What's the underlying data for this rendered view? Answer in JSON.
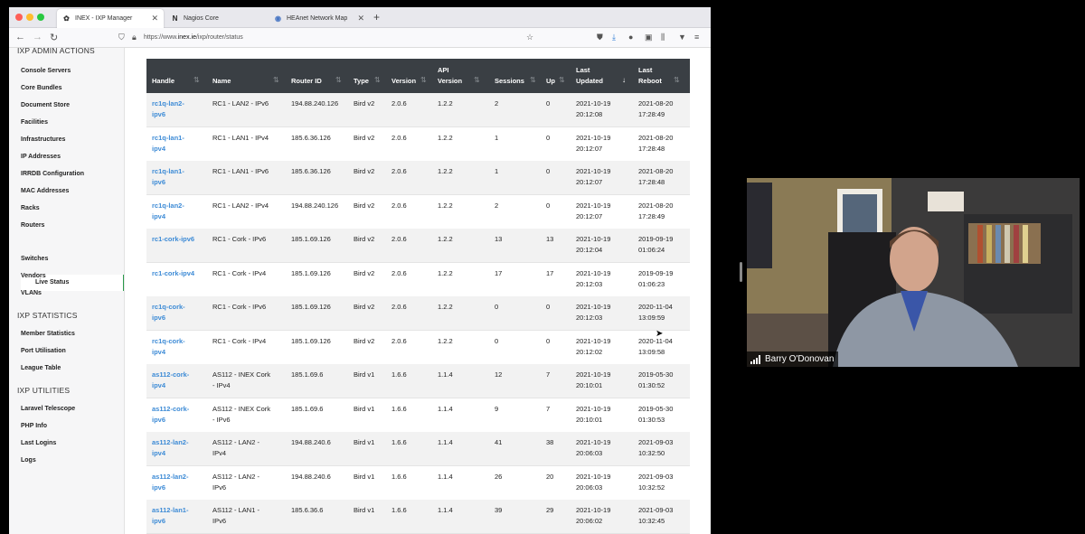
{
  "browser": {
    "tabs": [
      {
        "label": "INEX - IXP Manager",
        "icon": "ixp-favicon",
        "active": true
      },
      {
        "label": "Nagios Core",
        "icon": "nagios-favicon",
        "active": false
      },
      {
        "label": "HEAnet Network Map",
        "icon": "globe-favicon",
        "active": false
      }
    ],
    "url_prefix": "https://www.",
    "url_domain": "inex.ie",
    "url_path": "/ixp/router/status"
  },
  "sidebar": {
    "admin_title": "IXP ADMIN ACTIONS",
    "admin_items": [
      "Console Servers",
      "Core Bundles",
      "Document Store",
      "Facilities",
      "Infrastructures",
      "IP Addresses",
      "IRRDB Configuration",
      "MAC Addresses",
      "Racks",
      "Routers"
    ],
    "active_sub": "Live Status",
    "admin_items_after": [
      "Switches",
      "Vendors",
      "VLANs"
    ],
    "stats_title": "IXP STATISTICS",
    "stats_items": [
      "Member Statistics",
      "Port Utilisation",
      "League Table"
    ],
    "util_title": "IXP UTILITIES",
    "util_items": [
      "Laravel Telescope",
      "PHP Info",
      "Last Logins",
      "Logs"
    ]
  },
  "table": {
    "headers": {
      "handle": "Handle",
      "name": "Name",
      "router_id": "Router ID",
      "type": "Type",
      "version": "Version",
      "api_version_1": "API",
      "api_version_2": "Version",
      "sessions": "Sessions",
      "up": "Up",
      "last_updated_1": "Last",
      "last_updated_2": "Updated",
      "last_reboot_1": "Last",
      "last_reboot_2": "Reboot"
    },
    "rows": [
      {
        "handle": [
          "rc1q-lan2-",
          "ipv6"
        ],
        "name": [
          "RC1 - LAN2 - IPv6",
          ""
        ],
        "router_id": "194.88.240.126",
        "type": "Bird v2",
        "version": "2.0.6",
        "api": "1.2.2",
        "sessions": "2",
        "up": "0",
        "updated": [
          "2021-10-19",
          "20:12:08"
        ],
        "reboot": [
          "2021-08-20",
          "17:28:49"
        ]
      },
      {
        "handle": [
          "rc1q-lan1-",
          "ipv4"
        ],
        "name": [
          "RC1 - LAN1 - IPv4",
          ""
        ],
        "router_id": "185.6.36.126",
        "type": "Bird v2",
        "version": "2.0.6",
        "api": "1.2.2",
        "sessions": "1",
        "up": "0",
        "updated": [
          "2021-10-19",
          "20:12:07"
        ],
        "reboot": [
          "2021-08-20",
          "17:28:48"
        ]
      },
      {
        "handle": [
          "rc1q-lan1-",
          "ipv6"
        ],
        "name": [
          "RC1 - LAN1 - IPv6",
          ""
        ],
        "router_id": "185.6.36.126",
        "type": "Bird v2",
        "version": "2.0.6",
        "api": "1.2.2",
        "sessions": "1",
        "up": "0",
        "updated": [
          "2021-10-19",
          "20:12:07"
        ],
        "reboot": [
          "2021-08-20",
          "17:28:48"
        ]
      },
      {
        "handle": [
          "rc1q-lan2-",
          "ipv4"
        ],
        "name": [
          "RC1 - LAN2 - IPv4",
          ""
        ],
        "router_id": "194.88.240.126",
        "type": "Bird v2",
        "version": "2.0.6",
        "api": "1.2.2",
        "sessions": "2",
        "up": "0",
        "updated": [
          "2021-10-19",
          "20:12:07"
        ],
        "reboot": [
          "2021-08-20",
          "17:28:49"
        ]
      },
      {
        "handle": [
          "rc1-cork-ipv6",
          ""
        ],
        "name": [
          "RC1 - Cork - IPv6",
          ""
        ],
        "router_id": "185.1.69.126",
        "type": "Bird v2",
        "version": "2.0.6",
        "api": "1.2.2",
        "sessions": "13",
        "up": "13",
        "updated": [
          "2021-10-19",
          "20:12:04"
        ],
        "reboot": [
          "2019-09-19",
          "01:06:24"
        ]
      },
      {
        "handle": [
          "rc1-cork-ipv4",
          ""
        ],
        "name": [
          "RC1 - Cork - IPv4",
          ""
        ],
        "router_id": "185.1.69.126",
        "type": "Bird v2",
        "version": "2.0.6",
        "api": "1.2.2",
        "sessions": "17",
        "up": "17",
        "updated": [
          "2021-10-19",
          "20:12:03"
        ],
        "reboot": [
          "2019-09-19",
          "01:06:23"
        ]
      },
      {
        "handle": [
          "rc1q-cork-",
          "ipv6"
        ],
        "name": [
          "RC1 - Cork - IPv6",
          ""
        ],
        "router_id": "185.1.69.126",
        "type": "Bird v2",
        "version": "2.0.6",
        "api": "1.2.2",
        "sessions": "0",
        "up": "0",
        "updated": [
          "2021-10-19",
          "20:12:03"
        ],
        "reboot": [
          "2020-11-04",
          "13:09:59"
        ]
      },
      {
        "handle": [
          "rc1q-cork-",
          "ipv4"
        ],
        "name": [
          "RC1 - Cork - IPv4",
          ""
        ],
        "router_id": "185.1.69.126",
        "type": "Bird v2",
        "version": "2.0.6",
        "api": "1.2.2",
        "sessions": "0",
        "up": "0",
        "updated": [
          "2021-10-19",
          "20:12:02"
        ],
        "reboot": [
          "2020-11-04",
          "13:09:58"
        ]
      },
      {
        "handle": [
          "as112-cork-",
          "ipv4"
        ],
        "name": [
          "AS112 - INEX Cork",
          "- IPv4"
        ],
        "router_id": "185.1.69.6",
        "type": "Bird v1",
        "version": "1.6.6",
        "api": "1.1.4",
        "sessions": "12",
        "up": "7",
        "updated": [
          "2021-10-19",
          "20:10:01"
        ],
        "reboot": [
          "2019-05-30",
          "01:30:52"
        ]
      },
      {
        "handle": [
          "as112-cork-",
          "ipv6"
        ],
        "name": [
          "AS112 - INEX Cork",
          "- IPv6"
        ],
        "router_id": "185.1.69.6",
        "type": "Bird v1",
        "version": "1.6.6",
        "api": "1.1.4",
        "sessions": "9",
        "up": "7",
        "updated": [
          "2021-10-19",
          "20:10:01"
        ],
        "reboot": [
          "2019-05-30",
          "01:30:53"
        ]
      },
      {
        "handle": [
          "as112-lan2-",
          "ipv4"
        ],
        "name": [
          "AS112 - LAN2 -",
          "IPv4"
        ],
        "router_id": "194.88.240.6",
        "type": "Bird v1",
        "version": "1.6.6",
        "api": "1.1.4",
        "sessions": "41",
        "up": "38",
        "updated": [
          "2021-10-19",
          "20:06:03"
        ],
        "reboot": [
          "2021-09-03",
          "10:32:50"
        ]
      },
      {
        "handle": [
          "as112-lan2-",
          "ipv6"
        ],
        "name": [
          "AS112 - LAN2 -",
          "IPv6"
        ],
        "router_id": "194.88.240.6",
        "type": "Bird v1",
        "version": "1.6.6",
        "api": "1.1.4",
        "sessions": "26",
        "up": "20",
        "updated": [
          "2021-10-19",
          "20:06:03"
        ],
        "reboot": [
          "2021-09-03",
          "10:32:52"
        ]
      },
      {
        "handle": [
          "as112-lan1-",
          "ipv6"
        ],
        "name": [
          "AS112 - LAN1 -",
          "IPv6"
        ],
        "router_id": "185.6.36.6",
        "type": "Bird v1",
        "version": "1.6.6",
        "api": "1.1.4",
        "sessions": "39",
        "up": "29",
        "updated": [
          "2021-10-19",
          "20:06:02"
        ],
        "reboot": [
          "2021-09-03",
          "10:32:45"
        ]
      }
    ]
  },
  "video": {
    "participant_name": "Barry O'Donovan"
  },
  "colors": {
    "link": "#3d8bd6",
    "header_bg": "#3a3f44",
    "active_marker": "#2a9a4a"
  }
}
